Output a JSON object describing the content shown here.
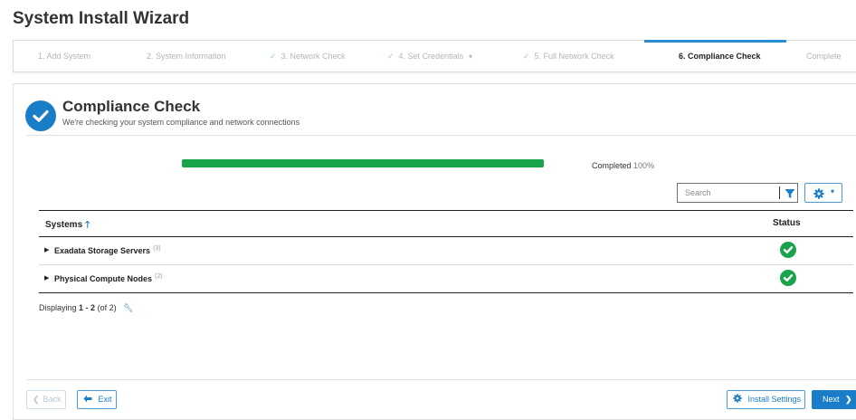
{
  "page": {
    "title": "System Install Wizard"
  },
  "steps": [
    {
      "label": "1. Add System"
    },
    {
      "label": "2. System Information"
    },
    {
      "label": "3. Network Check"
    },
    {
      "label": "4. Set Credentials"
    },
    {
      "label": "5. Full Network Check"
    },
    {
      "label": "6. Compliance Check"
    },
    {
      "label": "Complete"
    }
  ],
  "header": {
    "title": "Compliance Check",
    "subtitle": "We're checking your system compliance and network connections"
  },
  "progress": {
    "label": "Completed",
    "percent_text": "100%",
    "value": 1.0
  },
  "search": {
    "placeholder": "Search"
  },
  "table": {
    "col_systems": "Systems",
    "col_status": "Status",
    "rows": [
      {
        "name": "Exadata Storage Servers",
        "count": "(3)",
        "status": "ok"
      },
      {
        "name": "Physical Compute Nodes",
        "count": "(2)",
        "status": "ok"
      }
    ]
  },
  "paging": {
    "prefix": "Displaying",
    "range": "1 - 2",
    "total": "(of 2)"
  },
  "footer": {
    "back_label": "Back",
    "exit_label": "Exit",
    "settings_label": "Install Settings",
    "next_label": "Next"
  },
  "colors": {
    "accent": "#1a7dc8",
    "success": "#1aa34a",
    "active_step": "#2a8ccf"
  },
  "icons": [
    "check-circle-icon",
    "filter-icon",
    "gear-icon",
    "sort-up-arrow-icon",
    "wrench-icon",
    "exit-icon",
    "chevron-right-icon",
    "chevron-left-icon"
  ]
}
